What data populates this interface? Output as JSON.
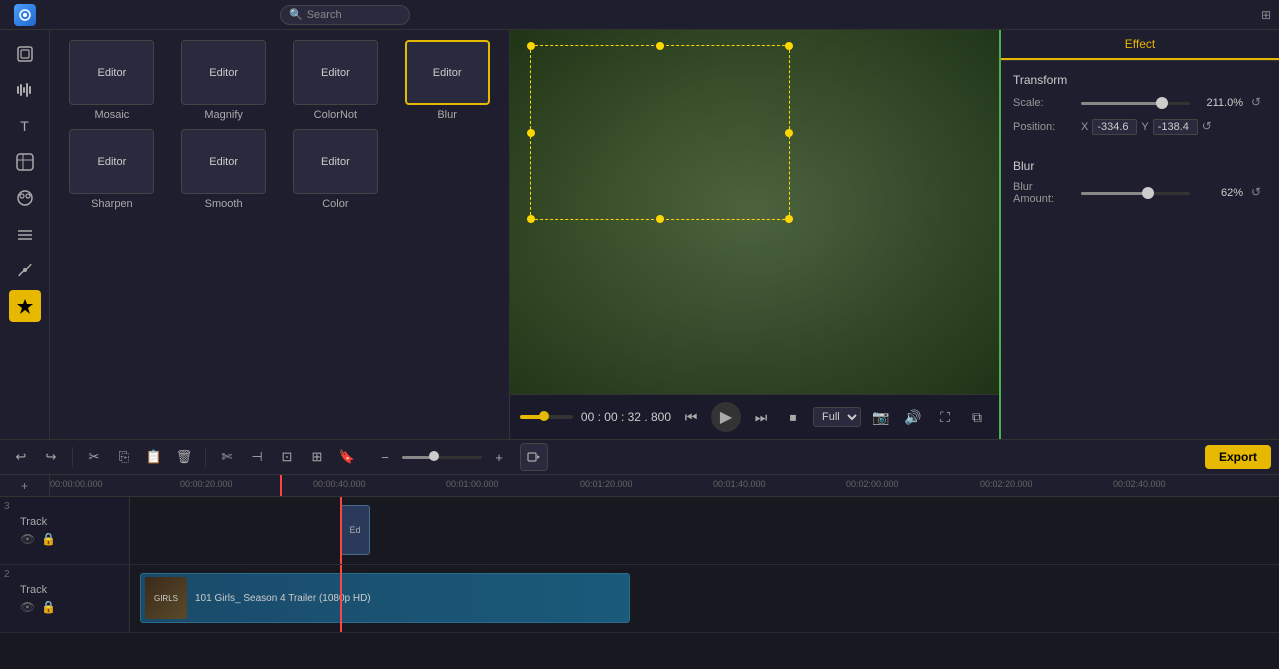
{
  "topbar": {
    "search_placeholder": "Search"
  },
  "effects": {
    "items": [
      {
        "label": "Editor",
        "name": "Mosaic",
        "active": false
      },
      {
        "label": "Editor",
        "name": "Magnify",
        "active": false
      },
      {
        "label": "Editor",
        "name": "ColorNot",
        "active": false
      },
      {
        "label": "Editor",
        "name": "Blur",
        "active": true
      },
      {
        "label": "Editor",
        "name": "Sharpen",
        "active": false
      },
      {
        "label": "Editor",
        "name": "Smooth",
        "active": false
      },
      {
        "label": "Editor",
        "name": "Color",
        "active": false
      }
    ]
  },
  "playback": {
    "time": "00 : 00 : 32 . 800",
    "quality": "Full"
  },
  "right_panel": {
    "tab": "Effect",
    "transform_label": "Transform",
    "scale_label": "Scale:",
    "scale_value": "211.0%",
    "scale_fill_pct": 75,
    "position_label": "Position:",
    "x_label": "X",
    "x_value": "-334.6",
    "y_label": "Y",
    "y_value": "-138.4",
    "blur_section": "Blur",
    "blur_amount_label": "Blur Amount:",
    "blur_value": "62%",
    "blur_fill_pct": 62
  },
  "toolbar": {
    "undo": "↩",
    "redo": "↪",
    "export_label": "Export",
    "zoom_minus": "−",
    "zoom_plus": "+"
  },
  "timeline": {
    "ruler": [
      "00:00:00.000",
      "00:00:20.000",
      "00:00:40.000",
      "00:01:00.000",
      "00:01:20.000",
      "00:01:40.000",
      "00:02:00.000",
      "00:02:20.000",
      "00:02:40.000"
    ],
    "tracks": [
      {
        "num": "3",
        "name": "Track",
        "has_clip": true,
        "clip_type": "effect",
        "clip_text": "Ed"
      },
      {
        "num": "2",
        "name": "Track",
        "has_clip": true,
        "clip_type": "video",
        "clip_title": "101 Girls_ Season 4 Trailer (1080p HD)"
      }
    ]
  }
}
